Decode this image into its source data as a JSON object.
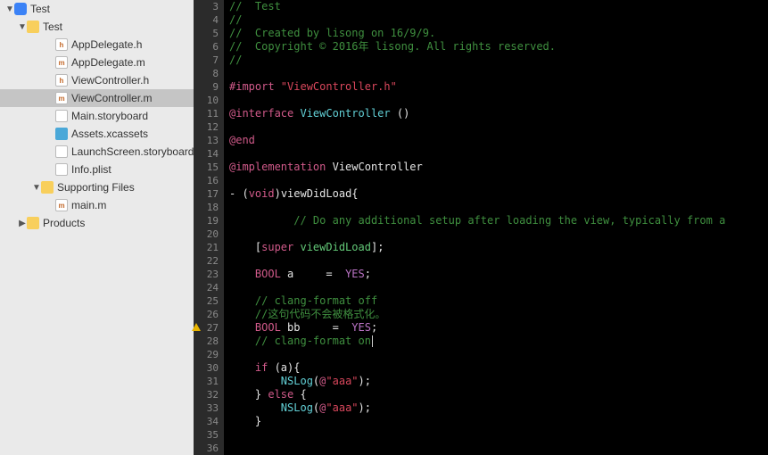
{
  "sidebar": {
    "items": [
      {
        "kind": "app",
        "expanded": true,
        "label": "Test",
        "indent": 0,
        "selected": false
      },
      {
        "kind": "folder",
        "expanded": true,
        "label": "Test",
        "indent": 1,
        "selected": false
      },
      {
        "kind": "h",
        "expanded": null,
        "label": "AppDelegate.h",
        "indent": 3,
        "selected": false,
        "glyph": "h"
      },
      {
        "kind": "m",
        "expanded": null,
        "label": "AppDelegate.m",
        "indent": 3,
        "selected": false,
        "glyph": "m"
      },
      {
        "kind": "h",
        "expanded": null,
        "label": "ViewController.h",
        "indent": 3,
        "selected": false,
        "glyph": "h"
      },
      {
        "kind": "m",
        "expanded": null,
        "label": "ViewController.m",
        "indent": 3,
        "selected": true,
        "glyph": "m"
      },
      {
        "kind": "sb",
        "expanded": null,
        "label": "Main.storyboard",
        "indent": 3,
        "selected": false
      },
      {
        "kind": "assets",
        "expanded": null,
        "label": "Assets.xcassets",
        "indent": 3,
        "selected": false
      },
      {
        "kind": "sb",
        "expanded": null,
        "label": "LaunchScreen.storyboard",
        "indent": 3,
        "selected": false
      },
      {
        "kind": "plist",
        "expanded": null,
        "label": "Info.plist",
        "indent": 3,
        "selected": false
      },
      {
        "kind": "folder",
        "expanded": true,
        "label": "Supporting Files",
        "indent": 2,
        "selected": false
      },
      {
        "kind": "m",
        "expanded": null,
        "label": "main.m",
        "indent": 3,
        "selected": false,
        "glyph": "m"
      },
      {
        "kind": "folder",
        "expanded": false,
        "label": "Products",
        "indent": 1,
        "selected": false
      }
    ]
  },
  "editor": {
    "first_line": 3,
    "warning_line": 27,
    "cursor_line": 28,
    "lines": [
      [
        {
          "c": "cmt",
          "t": "//  Test"
        }
      ],
      [
        {
          "c": "cmt",
          "t": "//"
        }
      ],
      [
        {
          "c": "cmt",
          "t": "//  Created by lisong on 16/9/9."
        }
      ],
      [
        {
          "c": "cmt",
          "t": "//  Copyright © 2016年 lisong. All rights reserved."
        }
      ],
      [
        {
          "c": "cmt",
          "t": "//"
        }
      ],
      [],
      [
        {
          "c": "kw",
          "t": "#import "
        },
        {
          "c": "str",
          "t": "\"ViewController.h\""
        }
      ],
      [],
      [
        {
          "c": "at",
          "t": "@interface "
        },
        {
          "c": "type",
          "t": "ViewController"
        },
        {
          "c": "plain",
          "t": " ()"
        }
      ],
      [],
      [
        {
          "c": "at",
          "t": "@end"
        }
      ],
      [],
      [
        {
          "c": "at",
          "t": "@implementation"
        },
        {
          "c": "plain",
          "t": " ViewController"
        }
      ],
      [],
      [
        {
          "c": "plain",
          "t": "- ("
        },
        {
          "c": "kw",
          "t": "void"
        },
        {
          "c": "plain",
          "t": ")viewDidLoad{"
        }
      ],
      [],
      [
        {
          "c": "plain",
          "t": "          "
        },
        {
          "c": "cmt",
          "t": "// Do any additional setup after loading the view, typically from a"
        }
      ],
      [],
      [
        {
          "c": "plain",
          "t": "    ["
        },
        {
          "c": "kw",
          "t": "super"
        },
        {
          "c": "plain",
          "t": " "
        },
        {
          "c": "method",
          "t": "viewDidLoad"
        },
        {
          "c": "plain",
          "t": "];"
        }
      ],
      [],
      [
        {
          "c": "plain",
          "t": "    "
        },
        {
          "c": "kw",
          "t": "BOOL"
        },
        {
          "c": "plain",
          "t": " a     =  "
        },
        {
          "c": "lit",
          "t": "YES"
        },
        {
          "c": "plain",
          "t": ";"
        }
      ],
      [],
      [
        {
          "c": "plain",
          "t": "    "
        },
        {
          "c": "cmt",
          "t": "// clang-format off"
        }
      ],
      [
        {
          "c": "plain",
          "t": "    "
        },
        {
          "c": "cmt",
          "t": "//这句代码不会被格式化。"
        }
      ],
      [
        {
          "c": "plain",
          "t": "    "
        },
        {
          "c": "kw",
          "t": "BOOL"
        },
        {
          "c": "plain",
          "t": " bb     =  "
        },
        {
          "c": "lit",
          "t": "YES"
        },
        {
          "c": "plain",
          "t": ";"
        }
      ],
      [
        {
          "c": "plain",
          "t": "    "
        },
        {
          "c": "cmt",
          "t": "// clang-format on"
        }
      ],
      [],
      [
        {
          "c": "plain",
          "t": "    "
        },
        {
          "c": "kw",
          "t": "if"
        },
        {
          "c": "plain",
          "t": " (a){"
        }
      ],
      [
        {
          "c": "plain",
          "t": "        "
        },
        {
          "c": "type",
          "t": "NSLog"
        },
        {
          "c": "plain",
          "t": "("
        },
        {
          "c": "kw",
          "t": "@"
        },
        {
          "c": "str",
          "t": "\"aaa\""
        },
        {
          "c": "plain",
          "t": ");"
        }
      ],
      [
        {
          "c": "plain",
          "t": "    } "
        },
        {
          "c": "kw",
          "t": "else"
        },
        {
          "c": "plain",
          "t": " {"
        }
      ],
      [
        {
          "c": "plain",
          "t": "        "
        },
        {
          "c": "type",
          "t": "NSLog"
        },
        {
          "c": "plain",
          "t": "("
        },
        {
          "c": "kw",
          "t": "@"
        },
        {
          "c": "str",
          "t": "\"aaa\""
        },
        {
          "c": "plain",
          "t": ");"
        }
      ],
      [
        {
          "c": "plain",
          "t": "    }"
        }
      ],
      [],
      []
    ]
  }
}
